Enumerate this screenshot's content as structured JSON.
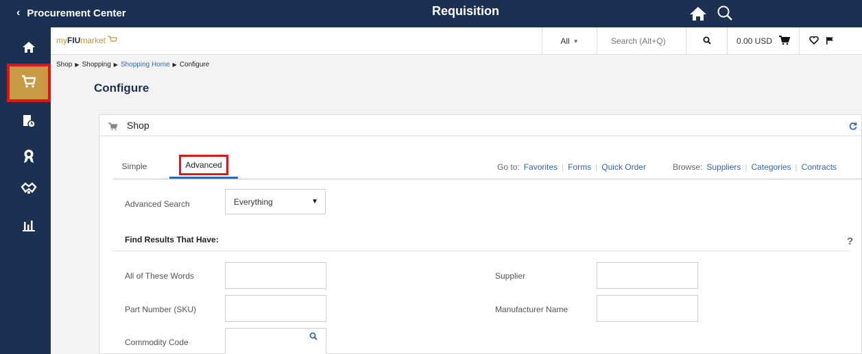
{
  "topbar": {
    "back_label": "Procurement Center",
    "title": "Requisition"
  },
  "sidebar": {
    "items": [
      {
        "name": "home",
        "icon": "home-icon"
      },
      {
        "name": "shop",
        "icon": "cart-icon",
        "active": true
      },
      {
        "name": "history",
        "icon": "document-clock-icon"
      },
      {
        "name": "awards",
        "icon": "ribbon-icon"
      },
      {
        "name": "partners",
        "icon": "handshake-icon"
      },
      {
        "name": "reports",
        "icon": "bar-chart-icon"
      }
    ]
  },
  "header": {
    "logo_my": "my",
    "logo_fiu": "FIU",
    "logo_market": "market",
    "filter": "All",
    "search_placeholder": "Search (Alt+Q)",
    "cart_total": "0.00 USD"
  },
  "breadcrumb": {
    "items": [
      "Shop",
      "Shopping",
      "Shopping Home",
      "Configure"
    ]
  },
  "page": {
    "title": "Configure"
  },
  "card": {
    "title": "Shop",
    "tabs": [
      "Simple",
      "Advanced"
    ],
    "active_tab": "Advanced",
    "goto_label": "Go to:",
    "goto_links": [
      "Favorites",
      "Forms",
      "Quick Order"
    ],
    "browse_label": "Browse:",
    "browse_links": [
      "Suppliers",
      "Categories",
      "Contracts"
    ],
    "advanced_search_label": "Advanced Search",
    "advanced_search_value": "Everything",
    "section_title": "Find Results That Have:",
    "help": "?",
    "fields": {
      "all_words": "All of These Words",
      "part_number": "Part Number (SKU)",
      "commodity_code": "Commodity Code",
      "supplier": "Supplier",
      "manufacturer": "Manufacturer Name"
    }
  },
  "colors": {
    "navy": "#1c3054",
    "active_nav": "#c99a45",
    "highlight": "#e01414",
    "link": "#2f67b3"
  }
}
